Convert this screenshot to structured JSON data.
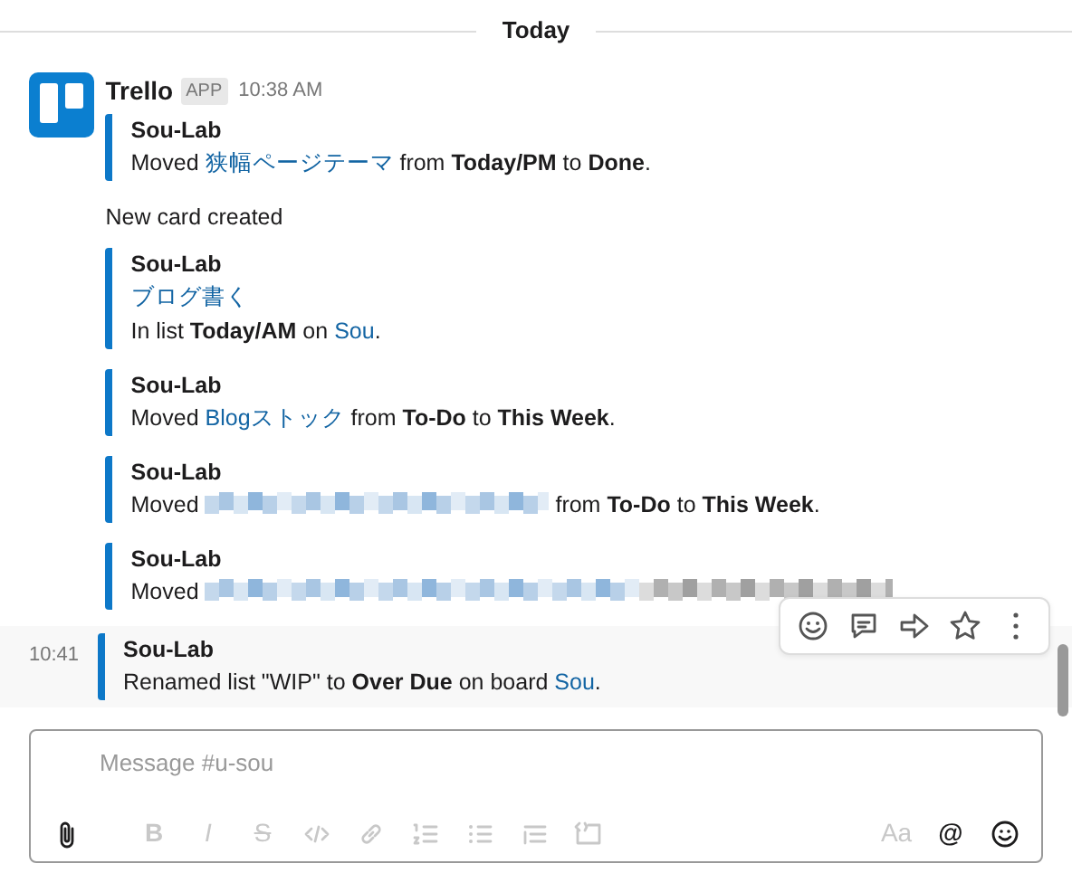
{
  "divider": {
    "label": "Today"
  },
  "message": {
    "sender": "Trello",
    "badge": "APP",
    "time": "10:38 AM",
    "blocks": [
      {
        "kind": "attachment",
        "title": "Sou-Lab",
        "lines": [
          [
            {
              "kind": "text",
              "text": "Moved "
            },
            {
              "kind": "link",
              "text": "狭幅ページテーマ"
            },
            {
              "kind": "text",
              "text": " from "
            },
            {
              "kind": "bold",
              "text": "Today/PM"
            },
            {
              "kind": "text",
              "text": " to "
            },
            {
              "kind": "bold",
              "text": "Done"
            },
            {
              "kind": "text",
              "text": "."
            }
          ]
        ]
      },
      {
        "kind": "text",
        "text": "New card created"
      },
      {
        "kind": "attachment",
        "title": "Sou-Lab",
        "lines": [
          [
            {
              "kind": "link",
              "text": "ブログ書く"
            }
          ],
          [
            {
              "kind": "text",
              "text": "In list "
            },
            {
              "kind": "bold",
              "text": "Today/AM"
            },
            {
              "kind": "text",
              "text": " on "
            },
            {
              "kind": "link",
              "text": "Sou"
            },
            {
              "kind": "text",
              "text": "."
            }
          ]
        ]
      },
      {
        "kind": "attachment",
        "title": "Sou-Lab",
        "lines": [
          [
            {
              "kind": "text",
              "text": "Moved "
            },
            {
              "kind": "link",
              "text": "Blogストック"
            },
            {
              "kind": "text",
              "text": " from "
            },
            {
              "kind": "bold",
              "text": "To-Do"
            },
            {
              "kind": "text",
              "text": " to "
            },
            {
              "kind": "bold",
              "text": "This Week"
            },
            {
              "kind": "text",
              "text": "."
            }
          ]
        ]
      },
      {
        "kind": "attachment",
        "title": "Sou-Lab",
        "lines": [
          [
            {
              "kind": "text",
              "text": "Moved "
            },
            {
              "kind": "redacted"
            },
            {
              "kind": "text",
              "text": " from "
            },
            {
              "kind": "bold",
              "text": "To-Do"
            },
            {
              "kind": "text",
              "text": " to "
            },
            {
              "kind": "bold",
              "text": "This Week"
            },
            {
              "kind": "text",
              "text": "."
            }
          ]
        ]
      },
      {
        "kind": "attachment",
        "title": "Sou-Lab",
        "lines": [
          [
            {
              "kind": "text",
              "text": "Moved "
            },
            {
              "kind": "redacted"
            }
          ]
        ]
      }
    ]
  },
  "followup": {
    "time": "10:41",
    "hovered": true,
    "title": "Sou-Lab",
    "lines": [
      [
        {
          "kind": "text",
          "text": "Renamed list \"WIP\" to "
        },
        {
          "kind": "bold",
          "text": "Over Due"
        },
        {
          "kind": "text",
          "text": " on board "
        },
        {
          "kind": "link",
          "text": "Sou"
        },
        {
          "kind": "text",
          "text": "."
        }
      ]
    ]
  },
  "composer": {
    "placeholder": "Message #u-sou",
    "tools": [
      {
        "kind": "attach",
        "disabled": false
      },
      {
        "kind": "bold",
        "label": "B",
        "disabled": true
      },
      {
        "kind": "italic",
        "label": "I",
        "disabled": true
      },
      {
        "kind": "strike",
        "label": "S",
        "disabled": true
      },
      {
        "kind": "code",
        "disabled": true
      },
      {
        "kind": "link",
        "disabled": true
      },
      {
        "kind": "ordered-list",
        "disabled": true
      },
      {
        "kind": "bullet-list",
        "disabled": true
      },
      {
        "kind": "quote",
        "disabled": true
      },
      {
        "kind": "code-block",
        "disabled": true
      },
      {
        "kind": "spacer"
      },
      {
        "kind": "format",
        "label": "Aa",
        "disabled": true
      },
      {
        "kind": "mention",
        "label": "@",
        "disabled": false
      },
      {
        "kind": "emoji",
        "disabled": false
      }
    ]
  }
}
